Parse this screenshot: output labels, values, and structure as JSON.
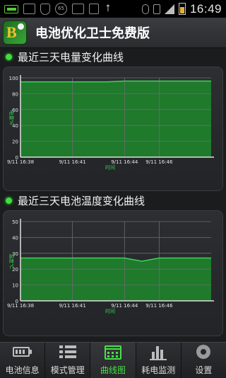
{
  "status_bar": {
    "time": "16:49",
    "icons": [
      "battery-app-icon",
      "usb-icon",
      "shield-icon",
      "clock-65-icon",
      "notification-icon",
      "download-icon",
      "upload-icon",
      "bluetooth-icon",
      "vibrate-icon",
      "signal-icon",
      "battery-charging-icon"
    ],
    "notification_badge": "65"
  },
  "app": {
    "title": "电池优化卫士免费版",
    "logo_letter": "B"
  },
  "sections": [
    {
      "title": "最近三天电量变化曲线"
    },
    {
      "title": "最近三天电池温度变化曲线"
    }
  ],
  "chart_data": [
    {
      "type": "area",
      "title": "最近三天电量变化曲线",
      "xlabel": "时间",
      "ylabel": "电量%",
      "ylim": [
        0,
        100
      ],
      "yticks": [
        0,
        20,
        40,
        60,
        80,
        100
      ],
      "xticks": [
        "9/11 16:38",
        "9/11 16:41",
        "9/11 16:44",
        "9/11 16:46"
      ],
      "x": [
        "9/11 16:38",
        "9/11 16:41",
        "9/11 16:43",
        "9/11 16:44",
        "9/11 16:46",
        "9/11 16:49"
      ],
      "values": [
        95,
        95,
        95,
        96,
        96,
        96
      ],
      "color": "#1f7a2c",
      "line_color": "#3fd25a"
    },
    {
      "type": "area",
      "title": "最近三天电池温度变化曲线",
      "xlabel": "时间",
      "ylabel": "温度℃",
      "ylim": [
        0,
        50
      ],
      "yticks": [
        0,
        10,
        20,
        30,
        40,
        50
      ],
      "xticks": [
        "9/11 16:38",
        "9/11 16:41",
        "9/11 16:44",
        "9/11 16:46"
      ],
      "x": [
        "9/11 16:38",
        "9/11 16:41",
        "9/11 16:44",
        "9/11 16:45",
        "9/11 16:46",
        "9/11 16:49"
      ],
      "values": [
        27,
        27,
        27,
        25,
        27,
        27
      ],
      "color": "#1f7a2c",
      "line_color": "#3fd25a"
    }
  ],
  "bottom_nav": [
    {
      "label": "电池信息",
      "icon": "battery-icon",
      "active": false
    },
    {
      "label": "模式管理",
      "icon": "list-icon",
      "active": false
    },
    {
      "label": "曲线图",
      "icon": "calendar-chart-icon",
      "active": true
    },
    {
      "label": "耗电监测",
      "icon": "bar-chart-icon",
      "active": false
    },
    {
      "label": "设置",
      "icon": "gear-icon",
      "active": false
    }
  ]
}
